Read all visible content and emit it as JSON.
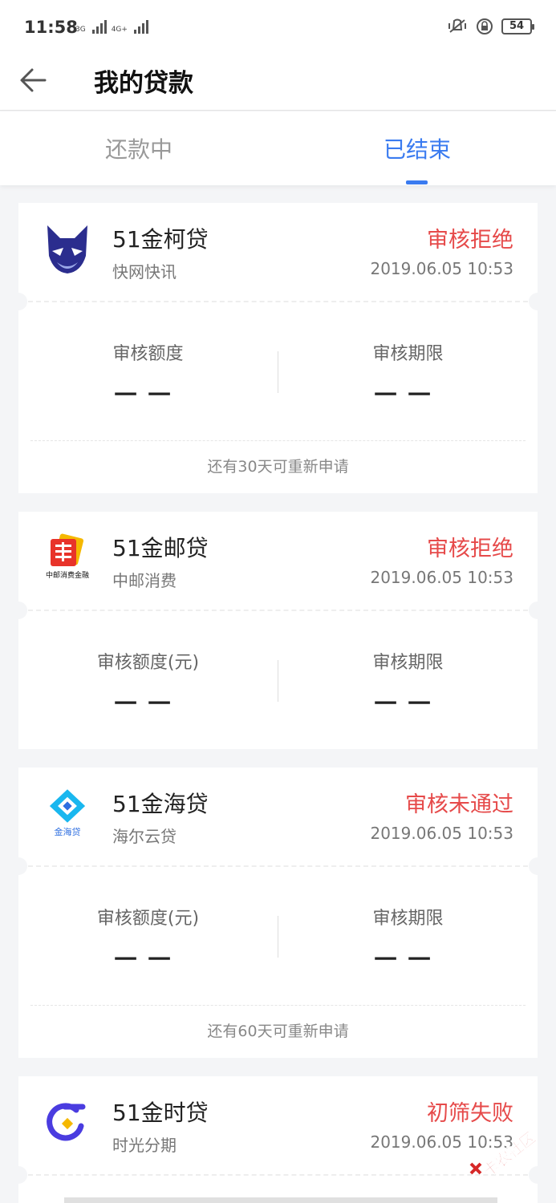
{
  "status_bar": {
    "time": "11:58",
    "net1": "3G",
    "net2": "4G+",
    "battery": "54"
  },
  "header": {
    "title": "我的贷款"
  },
  "tabs": [
    {
      "label": "还款中",
      "active": false
    },
    {
      "label": "已结束",
      "active": true
    }
  ],
  "cards": [
    {
      "name": "51金柯贷",
      "company": "快网快讯",
      "status": "审核拒绝",
      "time": "2019.06.05 10:53",
      "amount_label": "审核额度",
      "amount_value": "一一",
      "term_label": "审核期限",
      "term_value": "一一",
      "footer": "还有30天可重新申请"
    },
    {
      "name": "51金邮贷",
      "company": "中邮消费",
      "status": "审核拒绝",
      "time": "2019.06.05 10:53",
      "amount_label": "审核额度(元)",
      "amount_value": "一一",
      "term_label": "审核期限",
      "term_value": "一一",
      "logo_caption": "中邮消费金融"
    },
    {
      "name": "51金海贷",
      "company": "海尔云贷",
      "status": "审核未通过",
      "time": "2019.06.05 10:53",
      "amount_label": "审核额度(元)",
      "amount_value": "一一",
      "term_label": "审核期限",
      "term_value": "一一",
      "footer": "还有60天可重新申请",
      "logo_caption": "金海贷"
    },
    {
      "name": "51金时贷",
      "company": "时光分期",
      "status": "初筛失败",
      "time": "2019.06.05 10:53"
    }
  ],
  "watermark": "卡农社区",
  "colors": {
    "accent": "#3a7bf0",
    "reject": "#e64a4a"
  }
}
